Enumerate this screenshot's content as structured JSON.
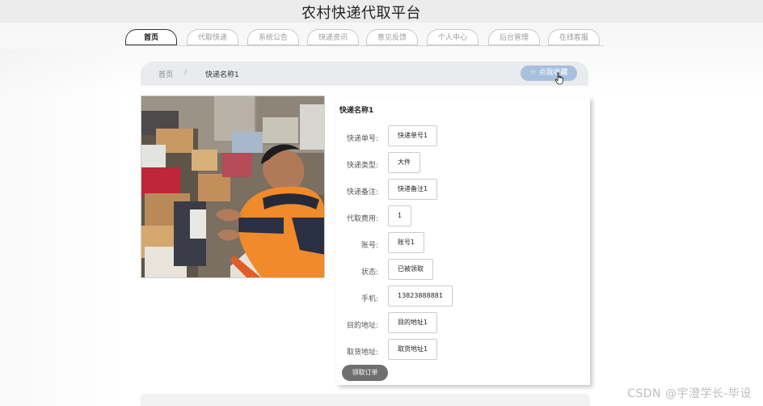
{
  "header": {
    "title": "农村快递代取平台"
  },
  "nav": {
    "tabs": [
      {
        "label": "首页",
        "active": true
      },
      {
        "label": "代取快递",
        "active": false
      },
      {
        "label": "系统公告",
        "active": false
      },
      {
        "label": "快递资讯",
        "active": false
      },
      {
        "label": "意见反馈",
        "active": false
      },
      {
        "label": "个人中心",
        "active": false
      },
      {
        "label": "后台管理",
        "active": false
      },
      {
        "label": "在线客服",
        "active": false
      }
    ]
  },
  "breadcrumb": {
    "home": "首页",
    "separator": "/",
    "current": "快递名称1"
  },
  "favorite_button": {
    "label": "☆ 点我收藏"
  },
  "detail": {
    "title": "快递名称1",
    "fields": [
      {
        "label": "快递单号:",
        "value": "快递单号1"
      },
      {
        "label": "快递类型:",
        "value": "大件"
      },
      {
        "label": "快递备注:",
        "value": "快递备注1"
      },
      {
        "label": "代取费用:",
        "value": "1"
      },
      {
        "label": "账号:",
        "value": "账号1"
      },
      {
        "label": "状态:",
        "value": "已被领取"
      },
      {
        "label": "手机:",
        "value": "13823888881"
      },
      {
        "label": "目的地址:",
        "value": "目的地址1"
      },
      {
        "label": "取货地址:",
        "value": "取货地址1"
      }
    ],
    "action_label": "领取订单"
  },
  "watermark": "CSDN @宇澄学长-毕设",
  "colors": {
    "favorite_bg": "#a7c0de",
    "action_bg": "#6f6f6f",
    "panel_bg": "#e9ebee"
  }
}
